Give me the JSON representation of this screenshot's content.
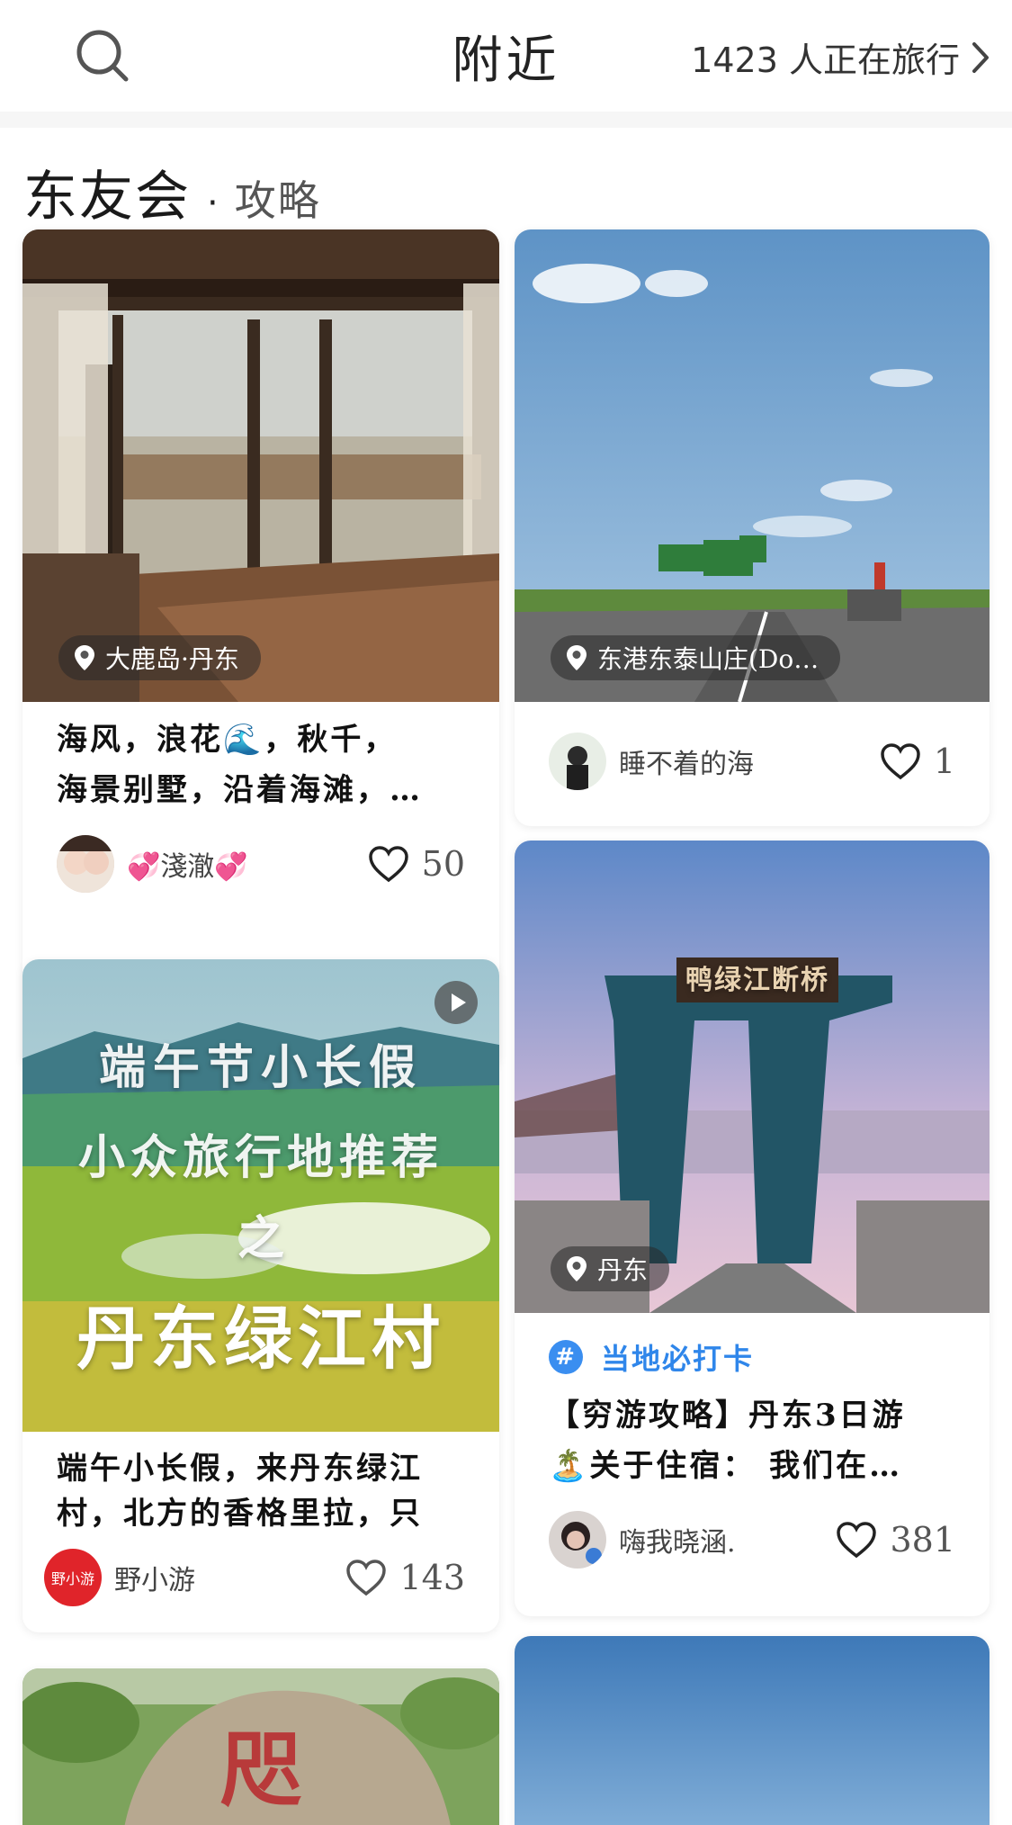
{
  "header": {
    "title": "附近",
    "travel_count": "1423 人正在旅行",
    "search_icon": "search-icon",
    "chevron_icon": "chevron-right-icon"
  },
  "section": {
    "name": "东友会",
    "separator": "·",
    "subtitle": "攻略"
  },
  "cards": {
    "card1": {
      "location": "大鹿岛·丹东",
      "title_line1": "海风，浪花🌊，秋千，",
      "title_line2": "海景别墅，沿着海滩，…",
      "author": "💞淺澈💞",
      "likes": "50"
    },
    "card2": {
      "location": "东港东泰山庄(Do…",
      "author": "睡不着的海",
      "likes": "1"
    },
    "card3": {
      "overlay_line1": "端午节小长假",
      "overlay_line2": "小众旅行地推荐",
      "overlay_line3": "之",
      "overlay_line4": "丹东绿江村",
      "title_line1": "端午小长假，来丹东绿江",
      "title_line2": "村，北方的香格里拉，只",
      "author": "野小游",
      "avatar_text": "野小游",
      "likes": "143"
    },
    "card4": {
      "location": "丹东",
      "sign_text": "鸭绿江断桥",
      "tag": "当地必打卡",
      "title_line1": "【穷游攻略】丹东3日游",
      "title_line2": "🏝️关于住宿： 我们在…",
      "author": "嗨我晓涵.",
      "likes": "381"
    },
    "card5": {
      "rock_text": "咫"
    }
  },
  "colors": {
    "accent_blue": "#2f86ea",
    "text_dark": "#111111"
  }
}
